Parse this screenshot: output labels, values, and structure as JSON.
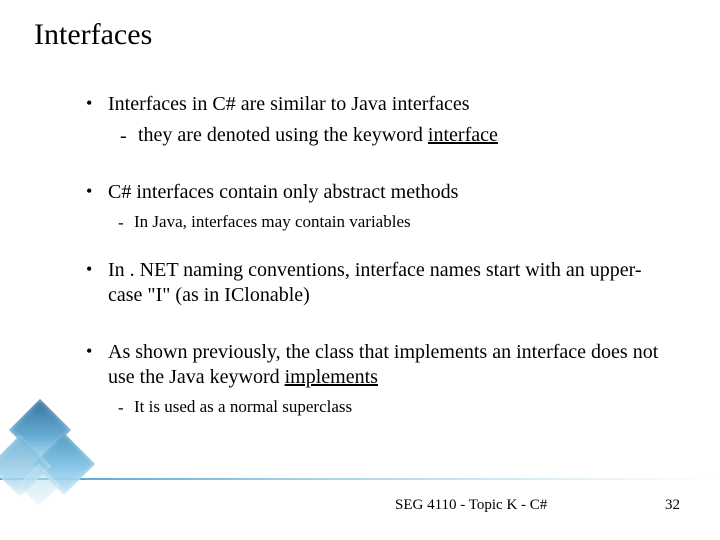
{
  "title": "Interfaces",
  "bullets": {
    "b1": {
      "main": "Interfaces in C# are similar to Java interfaces",
      "sub_prefix": "they are denoted using the keyword ",
      "sub_keyword": "interface"
    },
    "b2": {
      "main": "C# interfaces contain only abstract methods",
      "sub": "In Java, interfaces may contain variables"
    },
    "b3": {
      "main": "In . NET naming conventions, interface names start with an upper-case \"I\" (as in IClonable)"
    },
    "b4": {
      "main_prefix": "As shown previously, the class that implements an interface does not use the Java keyword ",
      "main_keyword": "implements",
      "sub": "It is used as a normal superclass"
    }
  },
  "footer": {
    "course": "SEG 4110 - Topic K - C#",
    "page": "32"
  }
}
